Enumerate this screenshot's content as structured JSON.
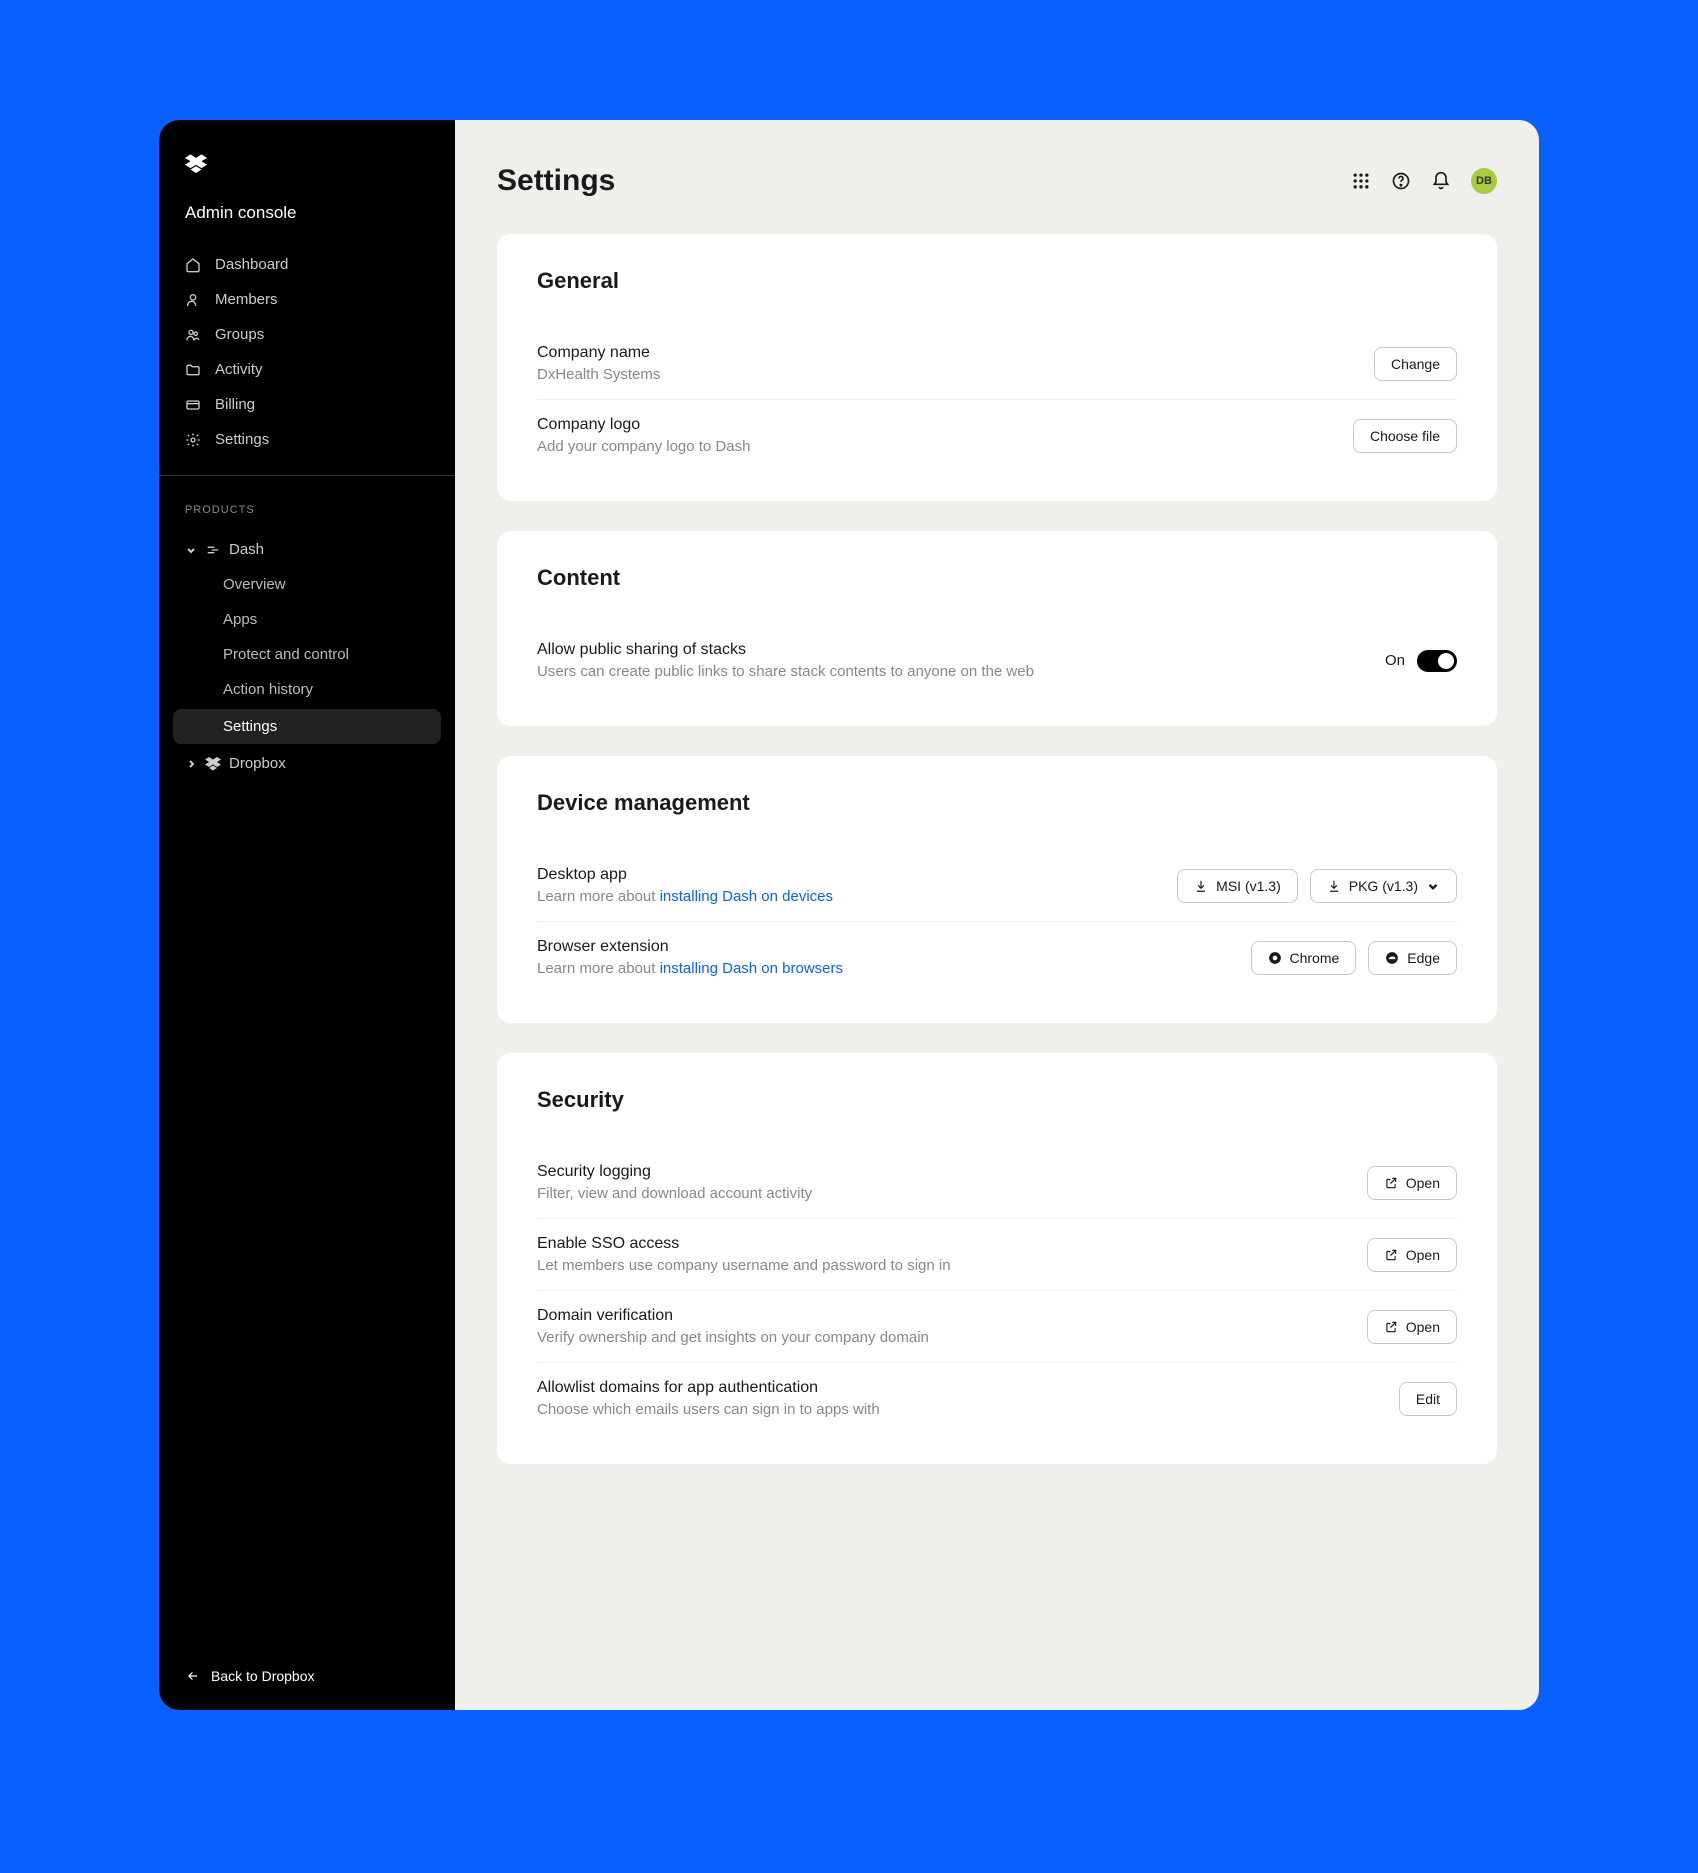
{
  "sidebar": {
    "admin_title": "Admin console",
    "nav": [
      {
        "label": "Dashboard"
      },
      {
        "label": "Members"
      },
      {
        "label": "Groups"
      },
      {
        "label": "Activity"
      },
      {
        "label": "Billing"
      },
      {
        "label": "Settings"
      }
    ],
    "products_label": "PRODUCTS",
    "dash_label": "Dash",
    "dash_sub": [
      {
        "label": "Overview"
      },
      {
        "label": "Apps"
      },
      {
        "label": "Protect and control"
      },
      {
        "label": "Action history"
      },
      {
        "label": "Settings"
      }
    ],
    "dropbox_label": "Dropbox",
    "back_label": "Back to Dropbox"
  },
  "header": {
    "title": "Settings",
    "avatar_initials": "DB"
  },
  "general": {
    "heading": "General",
    "company_name": {
      "title": "Company name",
      "desc": "DxHealth Systems",
      "btn": "Change"
    },
    "company_logo": {
      "title": "Company logo",
      "desc": "Add your company logo to Dash",
      "btn": "Choose file"
    }
  },
  "content_section": {
    "heading": "Content",
    "public_sharing": {
      "title": "Allow public sharing of stacks",
      "desc": "Users can create public links to share stack contents to anyone on the web",
      "state": "On"
    }
  },
  "device": {
    "heading": "Device management",
    "desktop": {
      "title": "Desktop app",
      "desc_prefix": "Learn more about ",
      "desc_link": "installing Dash on devices",
      "btn_msi": "MSI (v1.3)",
      "btn_pkg": "PKG (v1.3)"
    },
    "browser": {
      "title": "Browser extension",
      "desc_prefix": "Learn more about ",
      "desc_link": "installing Dash on browsers",
      "btn_chrome": "Chrome",
      "btn_edge": "Edge"
    }
  },
  "security": {
    "heading": "Security",
    "logging": {
      "title": "Security logging",
      "desc": "Filter, view and download account activity",
      "btn": "Open"
    },
    "sso": {
      "title": "Enable SSO access",
      "desc": "Let members use company username and password to sign in",
      "btn": "Open"
    },
    "domain": {
      "title": "Domain verification",
      "desc": "Verify ownership and get insights on your company domain",
      "btn": "Open"
    },
    "allowlist": {
      "title": "Allowlist domains for app authentication",
      "desc": "Choose which emails users can sign in to apps with",
      "btn": "Edit"
    }
  }
}
